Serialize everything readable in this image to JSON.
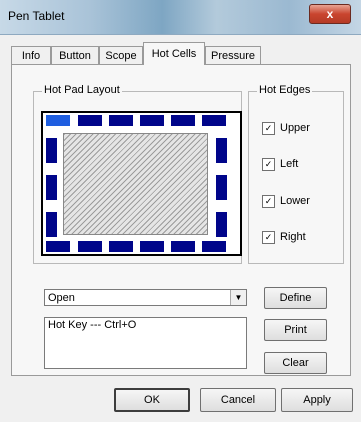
{
  "window": {
    "title": "Pen Tablet",
    "close_label": "x"
  },
  "tabs": [
    {
      "label": "Info",
      "active": false
    },
    {
      "label": "Button",
      "active": false
    },
    {
      "label": "Scope",
      "active": false
    },
    {
      "label": "Hot Cells",
      "active": true
    },
    {
      "label": "Pressure",
      "active": false
    }
  ],
  "hot_pad": {
    "label": "Hot Pad Layout"
  },
  "hot_edges": {
    "label": "Hot Edges",
    "items": [
      {
        "label": "Upper",
        "checked": true
      },
      {
        "label": "Left",
        "checked": true
      },
      {
        "label": "Lower",
        "checked": true
      },
      {
        "label": "Right",
        "checked": true
      }
    ]
  },
  "action": {
    "selected": "Open",
    "define_label": "Define"
  },
  "assignments": {
    "items": [
      "Hot Key --- Ctrl+O"
    ]
  },
  "side_buttons": {
    "print_label": "Print",
    "clear_label": "Clear"
  },
  "footer": {
    "ok_label": "OK",
    "cancel_label": "Cancel",
    "apply_label": "Apply"
  },
  "colors": {
    "cell": "#00058a",
    "cell_selected": "#1f5ee0"
  }
}
